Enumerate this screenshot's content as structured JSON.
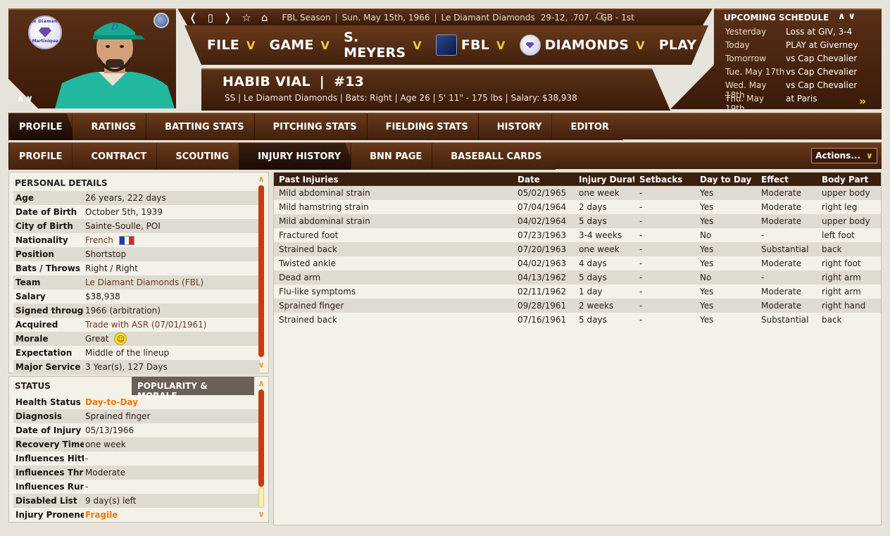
{
  "top_bar": {
    "season": "FBL Season",
    "date": "Sun. May 15th, 1966",
    "team": "Le Diamant Diamonds",
    "record": "29-12, .707, - GB - 1st"
  },
  "menu": [
    {
      "label": "FILE"
    },
    {
      "label": "GAME"
    },
    {
      "label": "S. MEYERS"
    },
    {
      "label": "FBL"
    },
    {
      "label": "DIAMONDS"
    },
    {
      "label": "PLAY"
    }
  ],
  "team_logo": {
    "arc_top": "Le Diamant",
    "arc_bottom": "Martinique"
  },
  "player": {
    "name": "HABIB VIAL",
    "number": "#13",
    "meta": "SS | Le Diamant Diamonds | Bats: Right | Age 26 | 5' 11\" - 175 lbs | Salary: $38,938"
  },
  "schedule": {
    "title": "UPCOMING SCHEDULE",
    "rows": [
      {
        "day": "Yesterday",
        "game": "Loss at GIV, 3-4"
      },
      {
        "day": "Today",
        "game": "PLAY at Giverney"
      },
      {
        "day": "Tomorrow",
        "game": "vs Cap Chevalier"
      },
      {
        "day": "Tue. May 17th",
        "game": "vs Cap Chevalier"
      },
      {
        "day": "Wed. May 18th",
        "game": "vs Cap Chevalier"
      },
      {
        "day": "Thu. May 19th",
        "game": "at Paris"
      }
    ]
  },
  "tabs_primary": [
    "PROFILE",
    "RATINGS",
    "BATTING STATS",
    "PITCHING STATS",
    "FIELDING STATS",
    "HISTORY",
    "EDITOR"
  ],
  "tabs_secondary": [
    "PROFILE",
    "CONTRACT",
    "SCOUTING",
    "INJURY HISTORY",
    "BNN PAGE",
    "BASEBALL CARDS"
  ],
  "actions_label": "Actions...",
  "personal": {
    "title": "PERSONAL DETAILS",
    "rows": [
      {
        "k": "Age",
        "v": "26 years, 222 days"
      },
      {
        "k": "Date of Birth",
        "v": "October 5th, 1939"
      },
      {
        "k": "City of Birth",
        "v": "Sainte-Soulle, POI"
      },
      {
        "k": "Nationality",
        "v": "French"
      },
      {
        "k": "Position",
        "v": "Shortstop"
      },
      {
        "k": "Bats / Throws",
        "v": "Right / Right"
      },
      {
        "k": "Team",
        "v": "Le Diamant Diamonds (FBL)"
      },
      {
        "k": "Salary",
        "v": "$38,938"
      },
      {
        "k": "Signed through",
        "v": "1966 (arbitration)"
      },
      {
        "k": "Acquired",
        "v": "Trade with ASR (07/01/1961)"
      },
      {
        "k": "Morale",
        "v": "Great"
      },
      {
        "k": "Expectation",
        "v": "Middle of the lineup"
      },
      {
        "k": "Major Service",
        "v": "3 Year(s), 127 Days"
      }
    ]
  },
  "status": {
    "tab_status": "STATUS",
    "tab_popularity": "POPULARITY & MORALE",
    "rows": [
      {
        "k": "Health Status",
        "v": "Day-to-Day"
      },
      {
        "k": "Diagnosis",
        "v": "Sprained finger"
      },
      {
        "k": "Date of Injury",
        "v": "05/13/1966"
      },
      {
        "k": "Recovery Time",
        "v": "one week"
      },
      {
        "k": "Influences Hitting",
        "v": "-"
      },
      {
        "k": "Influences Throwing",
        "v": "Moderate"
      },
      {
        "k": "Influences Running",
        "v": "-"
      },
      {
        "k": "Disabled List",
        "v": "9 day(s) left"
      },
      {
        "k": "Injury Proneness",
        "v": "Fragile"
      }
    ]
  },
  "injuries": {
    "headers": [
      "Past Injuries",
      "Date",
      "Injury Duration",
      "Setbacks",
      "Day to Day",
      "Effect",
      "Body Part"
    ],
    "rows": [
      [
        "Mild abdominal strain",
        "05/02/1965",
        "one week",
        "-",
        "Yes",
        "Moderate",
        "upper body"
      ],
      [
        "Mild hamstring strain",
        "07/04/1964",
        "2 days",
        "-",
        "Yes",
        "Moderate",
        "right leg"
      ],
      [
        "Mild abdominal strain",
        "04/02/1964",
        "5 days",
        "-",
        "Yes",
        "Moderate",
        "upper body"
      ],
      [
        "Fractured foot",
        "07/23/1963",
        "3-4 weeks",
        "-",
        "No",
        "-",
        "left foot"
      ],
      [
        "Strained back",
        "07/20/1963",
        "one week",
        "-",
        "Yes",
        "Substantial",
        "back"
      ],
      [
        "Twisted ankle",
        "04/02/1963",
        "4 days",
        "-",
        "Yes",
        "Moderate",
        "right foot"
      ],
      [
        "Dead arm",
        "04/13/1962",
        "5 days",
        "-",
        "No",
        "-",
        "right arm"
      ],
      [
        "Flu-like symptoms",
        "02/11/1962",
        "1 day",
        "-",
        "Yes",
        "Moderate",
        "right arm"
      ],
      [
        "Sprained finger",
        "09/28/1961",
        "2 weeks",
        "-",
        "Yes",
        "Moderate",
        "right hand"
      ],
      [
        "Strained back",
        "07/16/1961",
        "5 days",
        "-",
        "Yes",
        "Substantial",
        "back"
      ]
    ]
  }
}
